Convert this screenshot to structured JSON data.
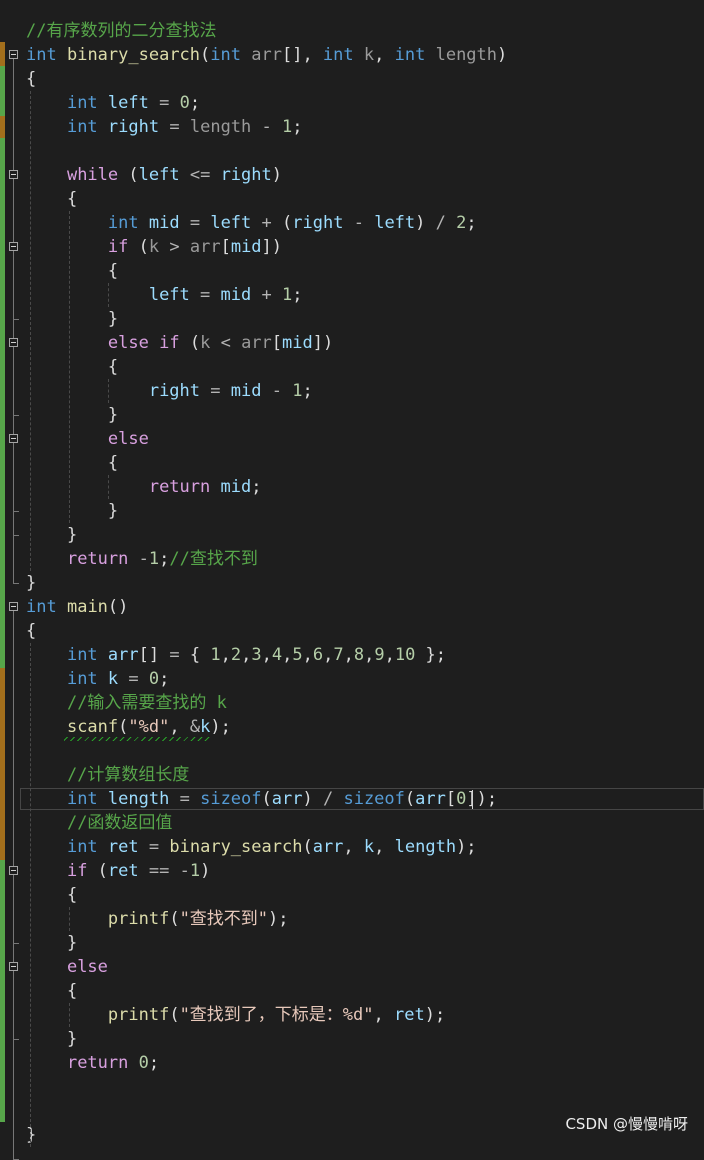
{
  "colors": {
    "background": "#1e1e1e",
    "keyword": "#569cd6",
    "control": "#d8a0df",
    "function": "#dcdcaa",
    "variable": "#9cdcfe",
    "parameter": "#9a9a9a",
    "number": "#b5cea8",
    "string": "#e8c9bb",
    "comment": "#57a64a",
    "change_margin": "#57a64a"
  },
  "watermark": "CSDN @慢慢啃呀",
  "lines": [
    [
      [
        "com",
        "//有序数列的二分查找法"
      ]
    ],
    [
      [
        "kw",
        "int"
      ],
      [
        "punc",
        " "
      ],
      [
        "fn",
        "binary_search"
      ],
      [
        "punc",
        "("
      ],
      [
        "kw",
        "int"
      ],
      [
        "punc",
        " "
      ],
      [
        "param",
        "arr"
      ],
      [
        "punc",
        "[], "
      ],
      [
        "kw",
        "int"
      ],
      [
        "punc",
        " "
      ],
      [
        "param",
        "k"
      ],
      [
        "punc",
        ", "
      ],
      [
        "kw",
        "int"
      ],
      [
        "punc",
        " "
      ],
      [
        "param",
        "length"
      ],
      [
        "punc",
        ")"
      ]
    ],
    [
      [
        "punc",
        "{"
      ]
    ],
    [
      [
        "punc",
        "    "
      ],
      [
        "kw",
        "int"
      ],
      [
        "punc",
        " "
      ],
      [
        "var",
        "left"
      ],
      [
        "punc",
        " "
      ],
      [
        "op",
        "="
      ],
      [
        "punc",
        " "
      ],
      [
        "num",
        "0"
      ],
      [
        "punc",
        ";"
      ]
    ],
    [
      [
        "punc",
        "    "
      ],
      [
        "kw",
        "int"
      ],
      [
        "punc",
        " "
      ],
      [
        "var",
        "right"
      ],
      [
        "punc",
        " "
      ],
      [
        "op",
        "="
      ],
      [
        "punc",
        " "
      ],
      [
        "param",
        "length"
      ],
      [
        "punc",
        " "
      ],
      [
        "op",
        "-"
      ],
      [
        "punc",
        " "
      ],
      [
        "num",
        "1"
      ],
      [
        "punc",
        ";"
      ]
    ],
    [],
    [
      [
        "punc",
        "    "
      ],
      [
        "ctrl",
        "while"
      ],
      [
        "punc",
        " ("
      ],
      [
        "var",
        "left"
      ],
      [
        "punc",
        " "
      ],
      [
        "op",
        "<="
      ],
      [
        "punc",
        " "
      ],
      [
        "var",
        "right"
      ],
      [
        "punc",
        ")"
      ]
    ],
    [
      [
        "punc",
        "    {"
      ]
    ],
    [
      [
        "punc",
        "        "
      ],
      [
        "kw",
        "int"
      ],
      [
        "punc",
        " "
      ],
      [
        "var",
        "mid"
      ],
      [
        "punc",
        " "
      ],
      [
        "op",
        "="
      ],
      [
        "punc",
        " "
      ],
      [
        "var",
        "left"
      ],
      [
        "punc",
        " "
      ],
      [
        "op",
        "+"
      ],
      [
        "punc",
        " ("
      ],
      [
        "var",
        "right"
      ],
      [
        "punc",
        " "
      ],
      [
        "op",
        "-"
      ],
      [
        "punc",
        " "
      ],
      [
        "var",
        "left"
      ],
      [
        "punc",
        ") "
      ],
      [
        "op",
        "/"
      ],
      [
        "punc",
        " "
      ],
      [
        "num",
        "2"
      ],
      [
        "punc",
        ";"
      ]
    ],
    [
      [
        "punc",
        "        "
      ],
      [
        "ctrl",
        "if"
      ],
      [
        "punc",
        " ("
      ],
      [
        "param",
        "k"
      ],
      [
        "punc",
        " "
      ],
      [
        "op",
        ">"
      ],
      [
        "punc",
        " "
      ],
      [
        "param",
        "arr"
      ],
      [
        "punc",
        "["
      ],
      [
        "var",
        "mid"
      ],
      [
        "punc",
        "])"
      ]
    ],
    [
      [
        "punc",
        "        {"
      ]
    ],
    [
      [
        "punc",
        "            "
      ],
      [
        "var",
        "left"
      ],
      [
        "punc",
        " "
      ],
      [
        "op",
        "="
      ],
      [
        "punc",
        " "
      ],
      [
        "var",
        "mid"
      ],
      [
        "punc",
        " "
      ],
      [
        "op",
        "+"
      ],
      [
        "punc",
        " "
      ],
      [
        "num",
        "1"
      ],
      [
        "punc",
        ";"
      ]
    ],
    [
      [
        "punc",
        "        }"
      ]
    ],
    [
      [
        "punc",
        "        "
      ],
      [
        "ctrl",
        "else"
      ],
      [
        "punc",
        " "
      ],
      [
        "ctrl",
        "if"
      ],
      [
        "punc",
        " ("
      ],
      [
        "param",
        "k"
      ],
      [
        "punc",
        " "
      ],
      [
        "op",
        "<"
      ],
      [
        "punc",
        " "
      ],
      [
        "param",
        "arr"
      ],
      [
        "punc",
        "["
      ],
      [
        "var",
        "mid"
      ],
      [
        "punc",
        "])"
      ]
    ],
    [
      [
        "punc",
        "        {"
      ]
    ],
    [
      [
        "punc",
        "            "
      ],
      [
        "var",
        "right"
      ],
      [
        "punc",
        " "
      ],
      [
        "op",
        "="
      ],
      [
        "punc",
        " "
      ],
      [
        "var",
        "mid"
      ],
      [
        "punc",
        " "
      ],
      [
        "op",
        "-"
      ],
      [
        "punc",
        " "
      ],
      [
        "num",
        "1"
      ],
      [
        "punc",
        ";"
      ]
    ],
    [
      [
        "punc",
        "        }"
      ]
    ],
    [
      [
        "punc",
        "        "
      ],
      [
        "ctrl",
        "else"
      ]
    ],
    [
      [
        "punc",
        "        {"
      ]
    ],
    [
      [
        "punc",
        "            "
      ],
      [
        "ctrl",
        "return"
      ],
      [
        "punc",
        " "
      ],
      [
        "var",
        "mid"
      ],
      [
        "punc",
        ";"
      ]
    ],
    [
      [
        "punc",
        "        }"
      ]
    ],
    [
      [
        "punc",
        "    }"
      ]
    ],
    [
      [
        "punc",
        "    "
      ],
      [
        "ctrl",
        "return"
      ],
      [
        "punc",
        " "
      ],
      [
        "op",
        "-"
      ],
      [
        "num",
        "1"
      ],
      [
        "punc",
        ";"
      ],
      [
        "com",
        "//查找不到"
      ]
    ],
    [
      [
        "punc",
        "}"
      ]
    ],
    [
      [
        "kw",
        "int"
      ],
      [
        "punc",
        " "
      ],
      [
        "fn",
        "main"
      ],
      [
        "punc",
        "()"
      ]
    ],
    [
      [
        "punc",
        "{"
      ]
    ],
    [
      [
        "punc",
        "    "
      ],
      [
        "kw",
        "int"
      ],
      [
        "punc",
        " "
      ],
      [
        "var",
        "arr"
      ],
      [
        "punc",
        "[] "
      ],
      [
        "op",
        "="
      ],
      [
        "punc",
        " { "
      ],
      [
        "num",
        "1"
      ],
      [
        "punc",
        ","
      ],
      [
        "num",
        "2"
      ],
      [
        "punc",
        ","
      ],
      [
        "num",
        "3"
      ],
      [
        "punc",
        ","
      ],
      [
        "num",
        "4"
      ],
      [
        "punc",
        ","
      ],
      [
        "num",
        "5"
      ],
      [
        "punc",
        ","
      ],
      [
        "num",
        "6"
      ],
      [
        "punc",
        ","
      ],
      [
        "num",
        "7"
      ],
      [
        "punc",
        ","
      ],
      [
        "num",
        "8"
      ],
      [
        "punc",
        ","
      ],
      [
        "num",
        "9"
      ],
      [
        "punc",
        ","
      ],
      [
        "num",
        "10"
      ],
      [
        "punc",
        " };"
      ]
    ],
    [
      [
        "punc",
        "    "
      ],
      [
        "kw",
        "int"
      ],
      [
        "punc",
        " "
      ],
      [
        "var",
        "k"
      ],
      [
        "punc",
        " "
      ],
      [
        "op",
        "="
      ],
      [
        "punc",
        " "
      ],
      [
        "num",
        "0"
      ],
      [
        "punc",
        ";"
      ]
    ],
    [
      [
        "punc",
        "    "
      ],
      [
        "com",
        "//输入需要查找的 k"
      ]
    ],
    [
      [
        "punc",
        "    "
      ],
      [
        "fn",
        "scanf"
      ],
      [
        "punc",
        "("
      ],
      [
        "str",
        "\"%d\""
      ],
      [
        "punc",
        ", "
      ],
      [
        "op",
        "&"
      ],
      [
        "var",
        "k"
      ],
      [
        "punc",
        ");"
      ]
    ],
    [],
    [
      [
        "punc",
        "    "
      ],
      [
        "com",
        "//计算数组长度"
      ]
    ],
    [
      [
        "punc",
        "    "
      ],
      [
        "kw",
        "int"
      ],
      [
        "punc",
        " "
      ],
      [
        "var",
        "length"
      ],
      [
        "punc",
        " "
      ],
      [
        "op",
        "="
      ],
      [
        "punc",
        " "
      ],
      [
        "kw",
        "sizeof"
      ],
      [
        "punc",
        "("
      ],
      [
        "var",
        "arr"
      ],
      [
        "punc",
        ") "
      ],
      [
        "op",
        "/"
      ],
      [
        "punc",
        " "
      ],
      [
        "kw",
        "sizeof"
      ],
      [
        "punc",
        "("
      ],
      [
        "var",
        "arr"
      ],
      [
        "punc",
        "["
      ],
      [
        "num",
        "0"
      ],
      [
        "punc",
        "]);"
      ]
    ],
    [
      [
        "punc",
        "    "
      ],
      [
        "com",
        "//函数返回值"
      ]
    ],
    [
      [
        "punc",
        "    "
      ],
      [
        "kw",
        "int"
      ],
      [
        "punc",
        " "
      ],
      [
        "var",
        "ret"
      ],
      [
        "punc",
        " "
      ],
      [
        "op",
        "="
      ],
      [
        "punc",
        " "
      ],
      [
        "fn",
        "binary_search"
      ],
      [
        "punc",
        "("
      ],
      [
        "var",
        "arr"
      ],
      [
        "punc",
        ", "
      ],
      [
        "var",
        "k"
      ],
      [
        "punc",
        ", "
      ],
      [
        "var",
        "length"
      ],
      [
        "punc",
        ");"
      ]
    ],
    [
      [
        "punc",
        "    "
      ],
      [
        "ctrl",
        "if"
      ],
      [
        "punc",
        " ("
      ],
      [
        "var",
        "ret"
      ],
      [
        "punc",
        " "
      ],
      [
        "op",
        "=="
      ],
      [
        "punc",
        " "
      ],
      [
        "op",
        "-"
      ],
      [
        "num",
        "1"
      ],
      [
        "punc",
        ")"
      ]
    ],
    [
      [
        "punc",
        "    {"
      ]
    ],
    [
      [
        "punc",
        "        "
      ],
      [
        "fn",
        "printf"
      ],
      [
        "punc",
        "("
      ],
      [
        "str",
        "\"查找不到\""
      ],
      [
        "punc",
        ");"
      ]
    ],
    [
      [
        "punc",
        "    }"
      ]
    ],
    [
      [
        "punc",
        "    "
      ],
      [
        "ctrl",
        "else"
      ]
    ],
    [
      [
        "punc",
        "    {"
      ]
    ],
    [
      [
        "punc",
        "        "
      ],
      [
        "fn",
        "printf"
      ],
      [
        "punc",
        "("
      ],
      [
        "str",
        "\"查找到了，下标是：%d\""
      ],
      [
        "punc",
        ", "
      ],
      [
        "var",
        "ret"
      ],
      [
        "punc",
        ");"
      ]
    ],
    [
      [
        "punc",
        "    }"
      ]
    ],
    [
      [
        "punc",
        "    "
      ],
      [
        "ctrl",
        "return"
      ],
      [
        "punc",
        " "
      ],
      [
        "num",
        "0"
      ],
      [
        "punc",
        ";"
      ]
    ],
    [],
    [],
    [
      [
        "punc",
        "}"
      ]
    ]
  ]
}
